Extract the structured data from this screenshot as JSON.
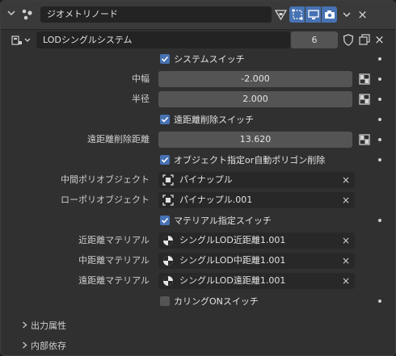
{
  "header": {
    "title": "ジオメトリノード",
    "close": "×"
  },
  "tree": {
    "name": "LODシングルシステム",
    "users": "6"
  },
  "inputs": {
    "system_switch": {
      "label": "システムスイッチ",
      "checked": true
    },
    "width": {
      "label": "中幅",
      "value": "-2.000"
    },
    "radius": {
      "label": "半径",
      "value": "2.000"
    },
    "far_delete_switch": {
      "label": "遠距離削除スイッチ",
      "checked": true
    },
    "far_delete_distance": {
      "label": "遠距離削除距離",
      "value": "13.620"
    },
    "object_or_auto": {
      "label": "オブジェクト指定or自動ポリゴン削除",
      "checked": true
    },
    "mid_poly_object": {
      "label": "中間ポリオブジェクト",
      "value": "パイナップル"
    },
    "low_poly_object": {
      "label": "ローポリオブジェクト",
      "value": "パイナップル.001"
    },
    "material_switch": {
      "label": "マテリアル指定スイッチ",
      "checked": true
    },
    "near_material": {
      "label": "近距離マテリアル",
      "value": "シングルLOD近距離1.001"
    },
    "mid_material": {
      "label": "中距離マテリアル",
      "value": "シングルLOD中距離1.001"
    },
    "far_material": {
      "label": "遠距離マテリアル",
      "value": "シングルLOD遠距離1.001"
    },
    "culling_switch": {
      "label": "カリングONスイッチ",
      "checked": false
    }
  },
  "subpanels": {
    "output_attributes": "出力属性",
    "internal_dependencies": "内部依存"
  },
  "colors": {
    "accent": "#4772b3",
    "panel": "#303030",
    "field": "#545454"
  }
}
